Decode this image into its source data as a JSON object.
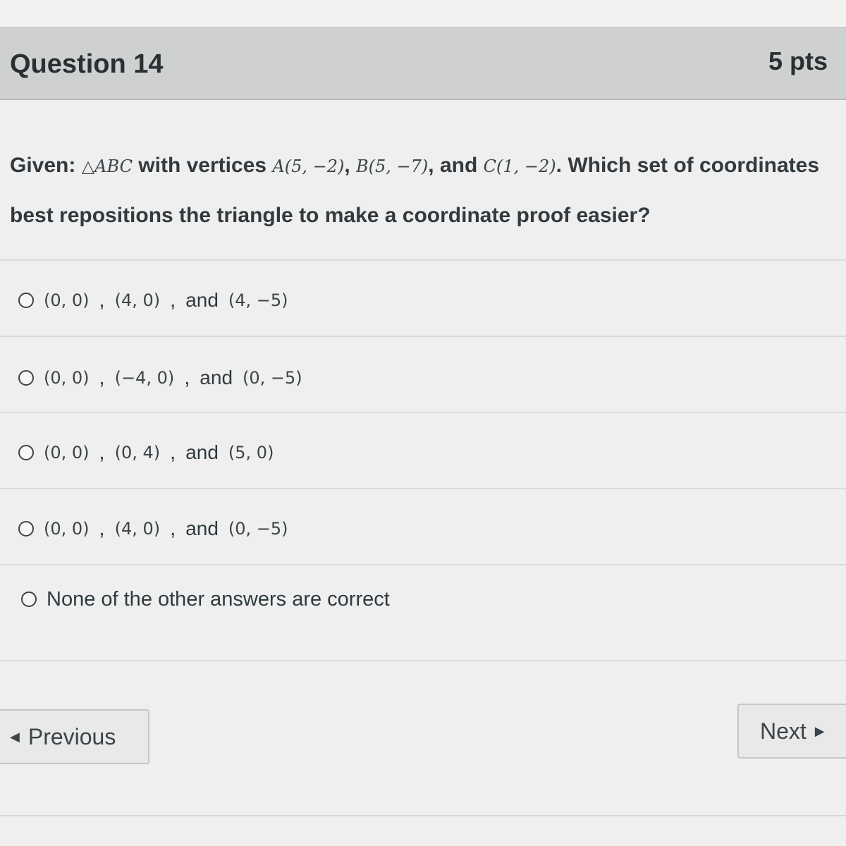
{
  "header": {
    "title": "Question 14",
    "points": "5 pts"
  },
  "question": {
    "given": "Given:",
    "triangle": "△ABC",
    "with_vertices": "with vertices",
    "vertex_a": "A(5, −2)",
    "vertex_b": "B(5, −7)",
    "and": "and",
    "vertex_c": "C(1, −2)",
    "tail": ". Which set of coordinates best repositions the triangle to make a coordinate proof easier?"
  },
  "answers": [
    {
      "p1": "(0, 0)",
      "p2": "(4, 0)",
      "and": "and",
      "p3": "(4, −5)"
    },
    {
      "p1": "(0, 0)",
      "p2": "(−4, 0)",
      "and": "and",
      "p3": "(0, −5)"
    },
    {
      "p1": "(0, 0)",
      "p2": "(0, 4)",
      "and": "and",
      "p3": "(5, 0)"
    },
    {
      "p1": "(0, 0)",
      "p2": "(4, 0)",
      "and": "and",
      "p3": "(0, −5)"
    }
  ],
  "answer_none": "None of the other answers are correct",
  "nav": {
    "previous": "Previous",
    "next": "Next"
  },
  "icons": {
    "previous": "caret-left-icon",
    "next": "caret-right-icon",
    "radio": "radio-unselected-icon"
  }
}
